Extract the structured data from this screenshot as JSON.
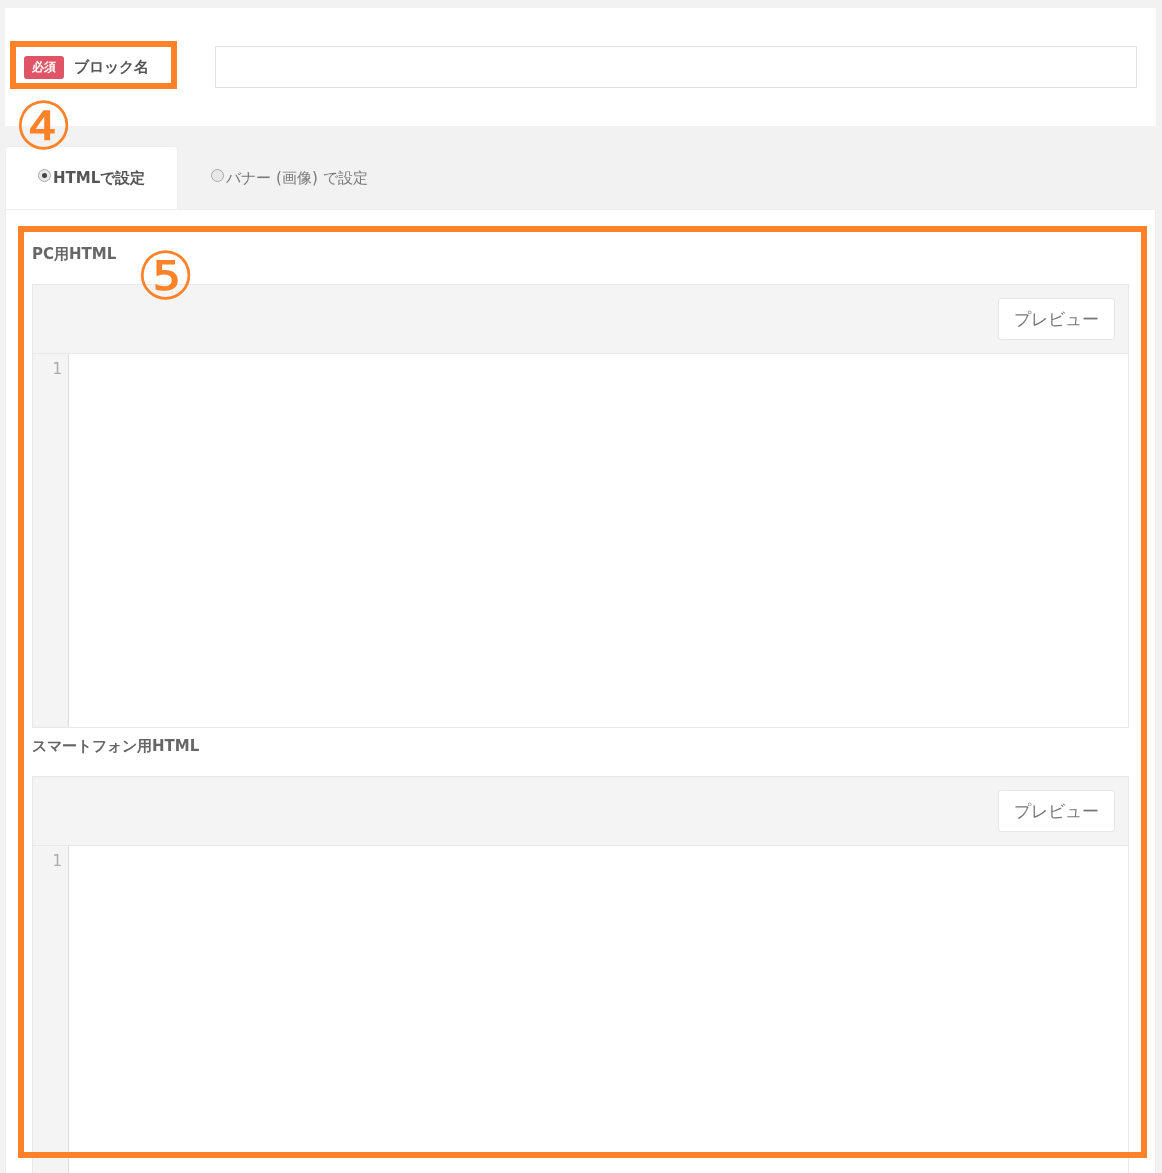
{
  "block_name": {
    "required_badge": "必須",
    "label": "ブロック名"
  },
  "tabs": [
    {
      "label": "HTMLで設定",
      "selected": true
    },
    {
      "label": "バナー (画像) で設定",
      "selected": false
    }
  ],
  "editors": [
    {
      "title": "PC用HTML",
      "preview_button": "プレビュー",
      "line_number": "1"
    },
    {
      "title": "スマートフォン用HTML",
      "preview_button": "プレビュー",
      "line_number": "1"
    }
  ],
  "annotations": [
    {
      "label": "④"
    },
    {
      "label": "⑤"
    }
  ]
}
